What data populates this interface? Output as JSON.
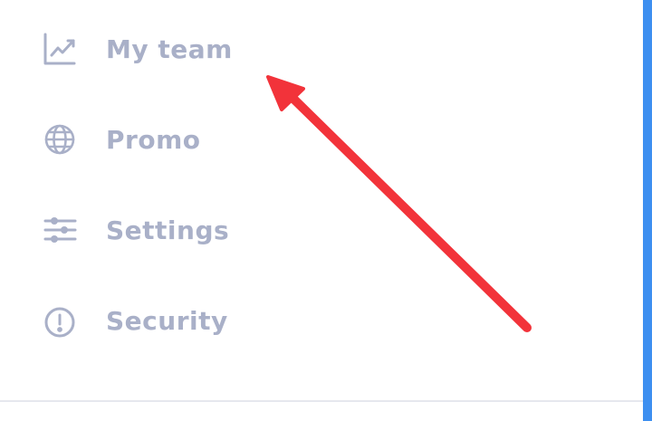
{
  "sidebar": {
    "items": [
      {
        "label": "My team",
        "icon": "chart-line-icon"
      },
      {
        "label": "Promo",
        "icon": "globe-icon"
      },
      {
        "label": "Settings",
        "icon": "sliders-icon"
      },
      {
        "label": "Security",
        "icon": "alert-circle-icon"
      }
    ]
  },
  "colors": {
    "menu_text": "#a9b0c8",
    "annotation_arrow": "#f2333a",
    "right_bar": "#3d8ff0",
    "divider": "#e6e8ee"
  }
}
